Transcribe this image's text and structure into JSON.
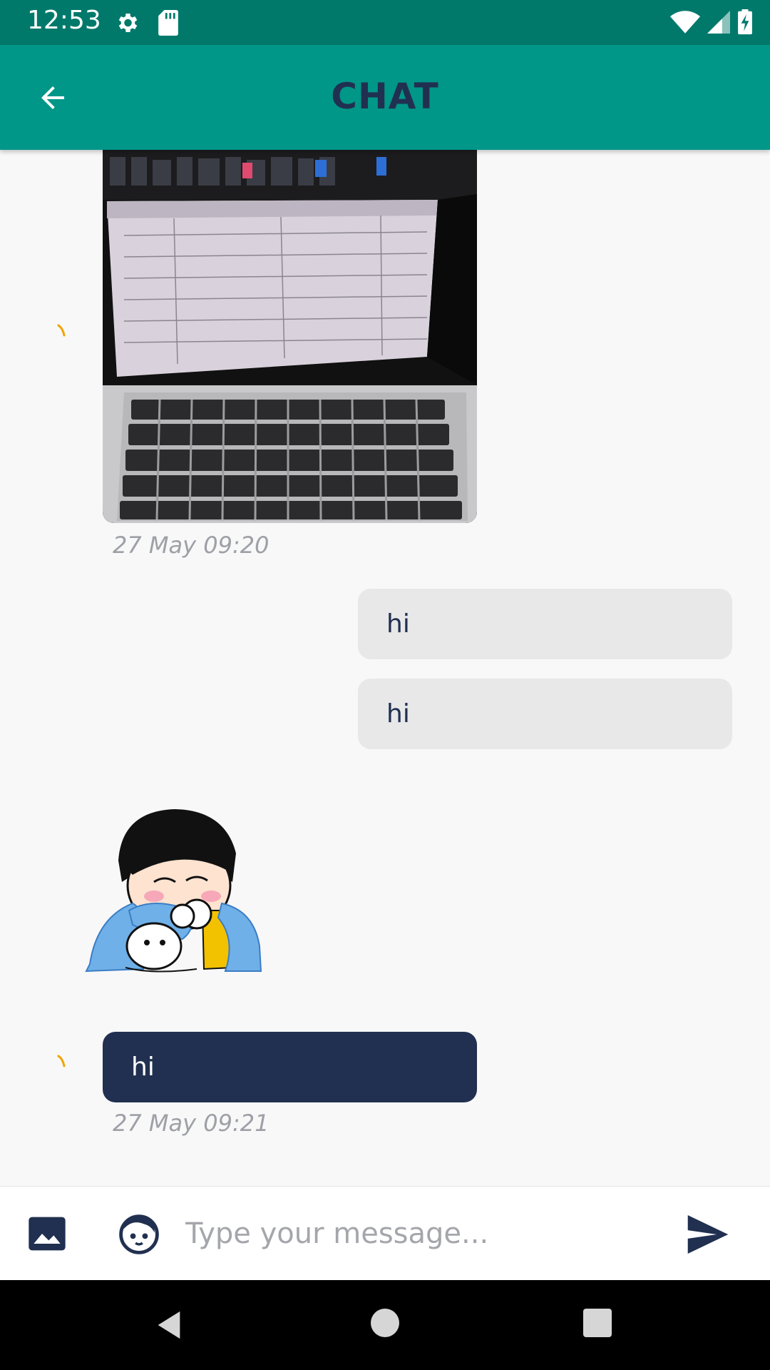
{
  "status_bar": {
    "time": "12:53",
    "icons": [
      "gear-icon",
      "sd-card-icon",
      "wifi-icon",
      "cellular-signal-icon",
      "battery-charging-icon"
    ]
  },
  "app_bar": {
    "title": "CHAT",
    "back_icon": "arrow-back-icon",
    "background_color": "#009688",
    "title_color": "#213050"
  },
  "messages": [
    {
      "type": "image",
      "direction": "incoming",
      "content": "photo of a laptop",
      "timestamp": "27 May 09:20"
    },
    {
      "type": "text",
      "direction": "outgoing",
      "text": "hi"
    },
    {
      "type": "text",
      "direction": "outgoing",
      "text": "hi"
    },
    {
      "type": "sticker",
      "direction": "incoming",
      "content": "crying girl sticker"
    },
    {
      "type": "text",
      "direction": "incoming",
      "text": "hi",
      "timestamp": "27 May 09:21"
    }
  ],
  "input_bar": {
    "placeholder": "Type your message...",
    "value": "",
    "image_icon": "image-icon",
    "emoji_icon": "emoji-face-icon",
    "send_icon": "send-icon"
  },
  "nav_bar": {
    "icons": [
      "nav-back-icon",
      "nav-home-icon",
      "nav-recents-icon"
    ]
  },
  "colors": {
    "primary": "#009688",
    "status_bar": "#00796b",
    "dark_bubble": "#213050",
    "light_bubble": "#e8e8e9",
    "spinner": "#f0a500"
  }
}
